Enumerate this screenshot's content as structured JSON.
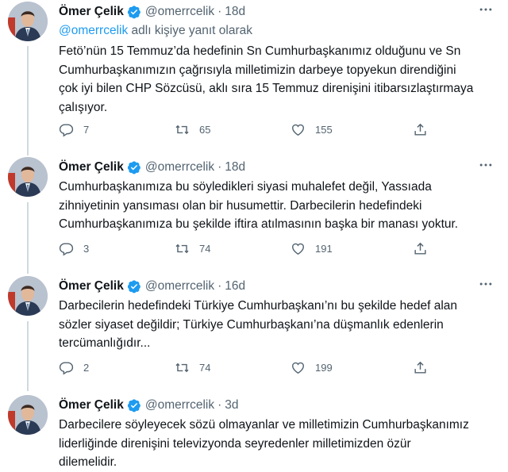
{
  "author": {
    "name": "Ömer Çelik",
    "handle": "@omerrcelik"
  },
  "tweets": [
    {
      "time": "18d",
      "reply_prefix": "@omerrcelik",
      "reply_suffix": " adlı kişiye yanıt olarak",
      "lines": [
        "Fetö’nün 15 Temmuz’da hedefinin Sn Cumhurbaşkanımız olduğunu ve Sn",
        "Cumhurbaşkanımızın çağrısıyla milletimizin darbeye topyekun direndiğini",
        "çok iyi bilen CHP Sözcüsü, aklı sıra 15 Temmuz direnişini itibarsızlaştırmaya",
        "çalışıyor."
      ],
      "replies": "7",
      "retweets": "65",
      "likes": "155"
    },
    {
      "time": "18d",
      "lines": [
        "Cumhurbaşkanımıza bu söyledikleri siyasi muhalefet değil, Yassıada",
        "zihniyetinin yansıması olan bir husumettir. Darbecilerin hedefindeki",
        "Cumhurbaşkanımıza bu şekilde iftira atılmasının başka bir manası yoktur."
      ],
      "replies": "3",
      "retweets": "74",
      "likes": "191"
    },
    {
      "time": "16d",
      "lines": [
        "Darbecilerin hedefindeki Türkiye Cumhurbaşkanı’nı bu şekilde hedef alan",
        "sözler siyaset değildir; Türkiye Cumhurbaşkanı’na düşmanlık edenlerin",
        "tercümanlığıdır..."
      ],
      "replies": "2",
      "retweets": "74",
      "likes": "199"
    },
    {
      "time": "3d",
      "lines": [
        "Darbecilere söyleyecek sözü olmayanlar ve milletimizin Cumhurbaşkanımız",
        "liderliğinde direnişini televizyonda seyredenler milletimizden özür",
        "dilemelidir."
      ]
    }
  ],
  "separator": "·",
  "colors": {
    "accent": "#1d9bf0",
    "secondary_text": "#536471",
    "text": "#0f1419",
    "thread_line": "#cfd9de"
  },
  "icons": [
    "verified-badge-icon",
    "more-icon",
    "reply-icon",
    "retweet-icon",
    "like-icon",
    "share-icon"
  ]
}
